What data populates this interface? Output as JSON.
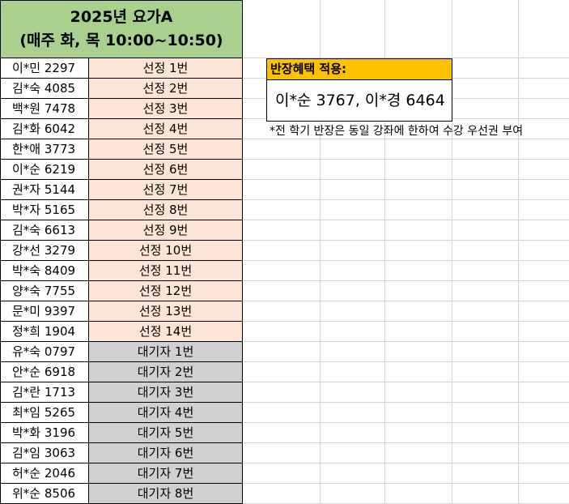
{
  "header": {
    "title_line1": "2025년 요가A",
    "title_line2": "(매주 화, 목 10:00~10:50)"
  },
  "roster": [
    {
      "name": "이*민 2297",
      "status": "선정 1번",
      "type": "selected"
    },
    {
      "name": "김*숙 4085",
      "status": "선정 2번",
      "type": "selected"
    },
    {
      "name": "백*원 7478",
      "status": "선정 3번",
      "type": "selected"
    },
    {
      "name": "김*화 6042",
      "status": "선정 4번",
      "type": "selected"
    },
    {
      "name": "한*애 3773",
      "status": "선정 5번",
      "type": "selected"
    },
    {
      "name": "이*순 6219",
      "status": "선정 6번",
      "type": "selected"
    },
    {
      "name": "권*자 5144",
      "status": "선정 7번",
      "type": "selected"
    },
    {
      "name": "박*자 5165",
      "status": "선정 8번",
      "type": "selected"
    },
    {
      "name": "김*숙 6613",
      "status": "선정 9번",
      "type": "selected"
    },
    {
      "name": "강*선 3279",
      "status": "선정 10번",
      "type": "selected"
    },
    {
      "name": "박*숙 8409",
      "status": "선정 11번",
      "type": "selected"
    },
    {
      "name": "양*숙 7755",
      "status": "선정 12번",
      "type": "selected"
    },
    {
      "name": "문*미 9397",
      "status": "선정 13번",
      "type": "selected"
    },
    {
      "name": "정*희 1904",
      "status": "선정 14번",
      "type": "selected"
    },
    {
      "name": "유*숙 0797",
      "status": "대기자 1번",
      "type": "waiting"
    },
    {
      "name": "안*순 6918",
      "status": "대기자 2번",
      "type": "waiting"
    },
    {
      "name": "김*란 1713",
      "status": "대기자 3번",
      "type": "waiting"
    },
    {
      "name": "최*임 5265",
      "status": "대기자 4번",
      "type": "waiting"
    },
    {
      "name": "박*화 3196",
      "status": "대기자 5번",
      "type": "waiting"
    },
    {
      "name": "김*임 3063",
      "status": "대기자 6번",
      "type": "waiting"
    },
    {
      "name": "허*순 2046",
      "status": "대기자 7번",
      "type": "waiting"
    },
    {
      "name": "위*순 8506",
      "status": "대기자 8번",
      "type": "waiting"
    }
  ],
  "benefit": {
    "title": "반장혜택 적용:",
    "value": "이*순 3767, 이*경 6464",
    "note": "*전 학기 반장은 동일 강좌에 한하여 수강 우선권 부여"
  },
  "colors": {
    "header_bg": "#a9d08e",
    "selected_bg": "#fce4d6",
    "waiting_bg": "#d0d0d0",
    "benefit_title_bg": "#ffc000"
  }
}
